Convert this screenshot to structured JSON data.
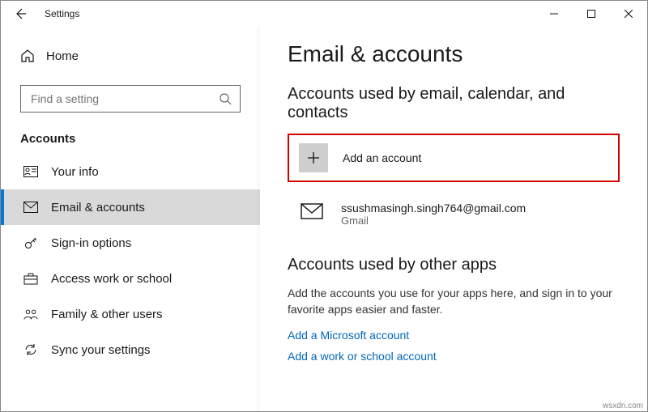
{
  "titlebar": {
    "title": "Settings"
  },
  "sidebar": {
    "home": "Home",
    "search_placeholder": "Find a setting",
    "section": "Accounts",
    "items": [
      {
        "label": "Your info"
      },
      {
        "label": "Email & accounts"
      },
      {
        "label": "Sign-in options"
      },
      {
        "label": "Access work or school"
      },
      {
        "label": "Family & other users"
      },
      {
        "label": "Sync your settings"
      }
    ]
  },
  "main": {
    "heading": "Email & accounts",
    "section1_title": "Accounts used by email, calendar, and contacts",
    "add_account_label": "Add an account",
    "account": {
      "email": "ssushmasingh.singh764@gmail.com",
      "provider": "Gmail"
    },
    "section2_title": "Accounts used by other apps",
    "section2_desc": "Add the accounts you use for your apps here, and sign in to your favorite apps easier and faster.",
    "link_ms": "Add a Microsoft account",
    "link_work": "Add a work or school account"
  },
  "watermark": "wsxdn.com"
}
